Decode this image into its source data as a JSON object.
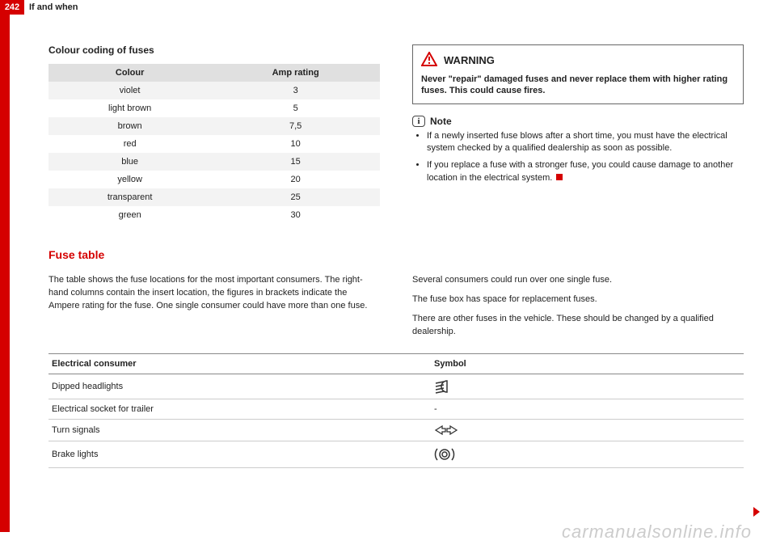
{
  "page_number": "242",
  "chapter": "If and when",
  "colour_section": {
    "heading": "Colour coding of fuses",
    "col_colour": "Colour",
    "col_amp": "Amp rating",
    "rows": [
      {
        "colour": "violet",
        "amp": "3"
      },
      {
        "colour": "light brown",
        "amp": "5"
      },
      {
        "colour": "brown",
        "amp": "7,5"
      },
      {
        "colour": "red",
        "amp": "10"
      },
      {
        "colour": "blue",
        "amp": "15"
      },
      {
        "colour": "yellow",
        "amp": "20"
      },
      {
        "colour": "transparent",
        "amp": "25"
      },
      {
        "colour": "green",
        "amp": "30"
      }
    ]
  },
  "warning": {
    "label": "WARNING",
    "text": "Never \"repair\" damaged fuses and never replace them with higher rating fuses. This could cause fires."
  },
  "note": {
    "label": "Note",
    "items": [
      "If a newly inserted fuse blows after a short time, you must have the electrical system checked by a qualified dealership as soon as possible.",
      "If you replace a fuse with a stronger fuse, you could cause damage to another location in the electrical system."
    ]
  },
  "fuse_table": {
    "title": "Fuse table",
    "intro_left": "The table shows the fuse locations for the most important consumers. The right-hand columns contain the insert location, the figures in brackets indicate the Ampere rating for the fuse.  One single consumer could have more than one fuse.",
    "intro_right_1": "Several consumers could run over one single fuse.",
    "intro_right_2": "The fuse box has space for replacement fuses.",
    "intro_right_3": "There are other fuses in the vehicle. These should be changed by a qualified dealership.",
    "col_consumer": "Electrical consumer",
    "col_symbol": "Symbol",
    "rows": [
      {
        "consumer": "Dipped headlights",
        "symbol": "dipped"
      },
      {
        "consumer": "Electrical socket for trailer",
        "symbol": "dash"
      },
      {
        "consumer": "Turn signals",
        "symbol": "turn"
      },
      {
        "consumer": "Brake lights",
        "symbol": "brake"
      }
    ]
  },
  "watermark": "carmanualsonline.info"
}
